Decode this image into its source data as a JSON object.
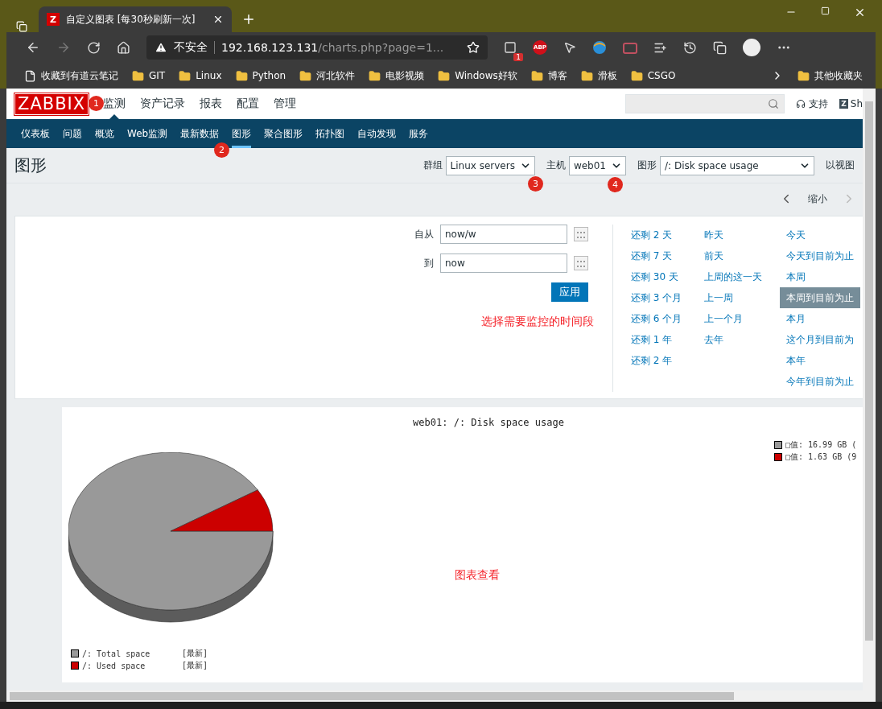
{
  "browser": {
    "tab": {
      "icon_letter": "Z",
      "title": "自定义图表 [每30秒刷新一次]"
    },
    "address": {
      "security": "不安全",
      "host": "192.168.123.131",
      "path": "/charts.php?page=1..."
    },
    "extension_badge": "1",
    "abp_label": "ABP",
    "bookmarks": [
      {
        "label": "收藏到有道云笔记",
        "kind": "page"
      },
      {
        "label": "GIT",
        "kind": "folder"
      },
      {
        "label": "Linux",
        "kind": "folder"
      },
      {
        "label": "Python",
        "kind": "folder"
      },
      {
        "label": "河北软件",
        "kind": "folder"
      },
      {
        "label": "电影视频",
        "kind": "folder"
      },
      {
        "label": "Windows好软",
        "kind": "folder"
      },
      {
        "label": "博客",
        "kind": "folder"
      },
      {
        "label": "滑板",
        "kind": "folder"
      },
      {
        "label": "CSGO",
        "kind": "folder"
      }
    ],
    "other_bookmarks": "其他收藏夹"
  },
  "zabbix": {
    "logo": "ZABBIX",
    "main_menu": [
      {
        "label": "监测",
        "selected": true
      },
      {
        "label": "资产记录",
        "selected": false
      },
      {
        "label": "报表",
        "selected": false
      },
      {
        "label": "配置",
        "selected": false
      },
      {
        "label": "管理",
        "selected": false
      }
    ],
    "support": "支持",
    "user_icon_letter": "Z",
    "user": "Sh",
    "sub_menu": [
      {
        "label": "仪表板",
        "selected": false
      },
      {
        "label": "问题",
        "selected": false
      },
      {
        "label": "概览",
        "selected": false
      },
      {
        "label": "Web监测",
        "selected": false
      },
      {
        "label": "最新数据",
        "selected": false
      },
      {
        "label": "图形",
        "selected": true
      },
      {
        "label": "聚合图形",
        "selected": false
      },
      {
        "label": "拓扑图",
        "selected": false
      },
      {
        "label": "自动发现",
        "selected": false
      },
      {
        "label": "服务",
        "selected": false
      }
    ],
    "page_title": "图形",
    "filters": [
      {
        "label": "群组",
        "value": "Linux servers"
      },
      {
        "label": "主机",
        "value": "web01"
      },
      {
        "label": "图形",
        "value": "/: Disk space usage"
      }
    ],
    "view_link": "以视图",
    "zoom_label": "缩小",
    "time_filter": {
      "from_label": "自从",
      "from_value": "now/w",
      "to_label": "到",
      "to_value": "now",
      "apply": "应用"
    },
    "quick_ranges": [
      [
        {
          "label": "还剩 2 天",
          "selected": false
        },
        {
          "label": "还剩 7 天",
          "selected": false
        },
        {
          "label": "还剩 30 天",
          "selected": false
        },
        {
          "label": "还剩 3 个月",
          "selected": false
        },
        {
          "label": "还剩 6 个月",
          "selected": false
        },
        {
          "label": "还剩 1 年",
          "selected": false
        },
        {
          "label": "还剩 2 年",
          "selected": false
        }
      ],
      [
        {
          "label": "昨天",
          "selected": false
        },
        {
          "label": "前天",
          "selected": false
        },
        {
          "label": "上周的这一天",
          "selected": false
        },
        {
          "label": "上一周",
          "selected": false
        },
        {
          "label": "上一个月",
          "selected": false
        },
        {
          "label": "去年",
          "selected": false
        }
      ],
      [
        {
          "label": "今天",
          "selected": false
        },
        {
          "label": "今天到目前为止",
          "selected": false
        },
        {
          "label": "本周",
          "selected": false
        },
        {
          "label": "本周到目前为止",
          "selected": true
        },
        {
          "label": "本月",
          "selected": false
        },
        {
          "label": "这个月到目前为",
          "selected": false
        },
        {
          "label": "本年",
          "selected": false
        },
        {
          "label": "今年到目前为止",
          "selected": false
        }
      ]
    ],
    "graph": {
      "title": "web01: /: Disk space usage",
      "value_legend": [
        {
          "text": "□值: 16.99 GB (",
          "color": "#999999"
        },
        {
          "text": "□值: 1.63 GB (9",
          "color": "#cc0000"
        }
      ],
      "items": [
        {
          "name": "/: Total space",
          "tag": "[最新]",
          "color": "#999999"
        },
        {
          "name": "/: Used space",
          "tag": "[最新]",
          "color": "#cc0000"
        }
      ]
    }
  },
  "annotations": {
    "badges": [
      "1",
      "2",
      "3",
      "4"
    ],
    "notes": [
      "选择需要监控的时间段",
      "图表查看"
    ]
  }
}
